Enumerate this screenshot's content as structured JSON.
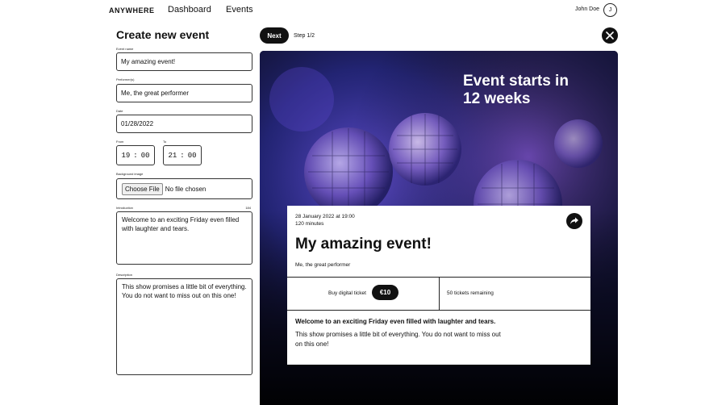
{
  "nav": {
    "brand": "ANYWHERE",
    "links": [
      "Dashboard",
      "Events"
    ],
    "user_name": "John Doe",
    "avatar_initial": "J"
  },
  "form": {
    "title": "Create new event",
    "event_name": {
      "label": "Event name",
      "value": "My amazing event!"
    },
    "performers": {
      "label": "Performer(s)",
      "value": "Me, the great performer"
    },
    "date": {
      "label": "Date",
      "value": "01/28/2022"
    },
    "from": {
      "label": "From",
      "hours": "19",
      "minutes": "00"
    },
    "to": {
      "label": "To",
      "hours": "21",
      "minutes": "00"
    },
    "background_image": {
      "label": "Background image",
      "button": "Choose File",
      "status": "No file chosen"
    },
    "introduction": {
      "label": "Introduction",
      "char_count": "184",
      "value": "Welcome to an exciting Friday even filled with laughter and tears."
    },
    "description": {
      "label": "Description",
      "value": "This show promises a little bit of everything. You do not want to miss out on this one!"
    }
  },
  "preview_bar": {
    "next_label": "Next",
    "step_label": "Step 1/2",
    "close_icon": "close-icon"
  },
  "preview": {
    "countdown": "Event starts in 12 weeks",
    "date_line": "28 January 2022 at 19:00",
    "duration_line": "120 minutes",
    "share_icon": "share-arrow-icon",
    "title": "My amazing event!",
    "performer": "Me, the great performer",
    "buy_label": "Buy digital ticket",
    "price": "€10",
    "tickets_remaining": "50 tickets remaining",
    "intro": "Welcome to an exciting Friday even filled with laughter and tears.",
    "description": "This show promises a little bit of everything. You do not want to miss out on this one!"
  },
  "colors": {
    "accent_dark": "#111111",
    "preview_bg": "#0d0f24",
    "disco_purple": "#7b4fc9",
    "disco_blue": "#3a4bd8"
  }
}
